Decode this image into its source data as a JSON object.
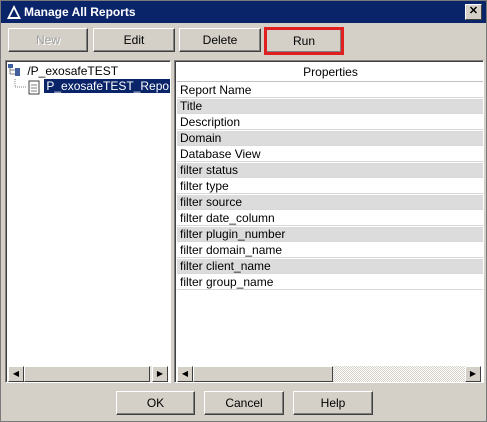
{
  "window": {
    "title": "Manage All Reports",
    "close_glyph": "✕"
  },
  "toolbar": {
    "new_label": "New",
    "edit_label": "Edit",
    "delete_label": "Delete",
    "run_label": "Run"
  },
  "tree": {
    "root_label": "/P_exosafeTEST",
    "child_label": "P_exosafeTEST_Repo"
  },
  "properties": {
    "header": "Properties",
    "rows": [
      "Report Name",
      "Title",
      "Description",
      "Domain",
      "Database View",
      "filter status",
      "filter type",
      "filter source",
      "filter date_column",
      "filter plugin_number",
      "filter domain_name",
      "filter client_name",
      "filter group_name"
    ]
  },
  "footer": {
    "ok_label": "OK",
    "cancel_label": "Cancel",
    "help_label": "Help"
  },
  "colors": {
    "titlebar": "#0a246a",
    "selection": "#0a246a",
    "highlight_border": "#e02020"
  }
}
